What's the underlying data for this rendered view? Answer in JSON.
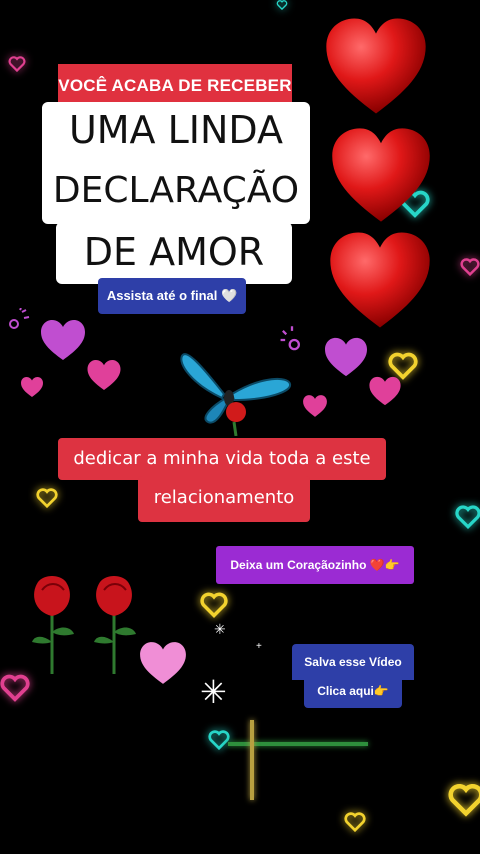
{
  "top_banner": {
    "label": "VOCÊ ACABA DE RECEBER"
  },
  "title": {
    "line1": "UMA LINDA",
    "line2": "DECLARAÇÃO",
    "line3": "DE AMOR"
  },
  "watch_pill": {
    "label": "Assista até o final 🤍"
  },
  "caption": {
    "line1": "dedicar a minha vida toda a este",
    "line2": "relacionamento"
  },
  "heart_prompt": {
    "label": "Deixa um Coraçãozinho ❤️👉"
  },
  "save_prompt": {
    "line1": "Salva esse Vídeo",
    "line2": "Clica aqui👉"
  },
  "colors": {
    "red": "#e0313f",
    "blue": "#2e3fa8",
    "purple": "#9b2bd3",
    "background": "#000000"
  },
  "icons": [
    "heart-icon",
    "butterfly-icon",
    "rose-icon",
    "sparkle-icon"
  ]
}
